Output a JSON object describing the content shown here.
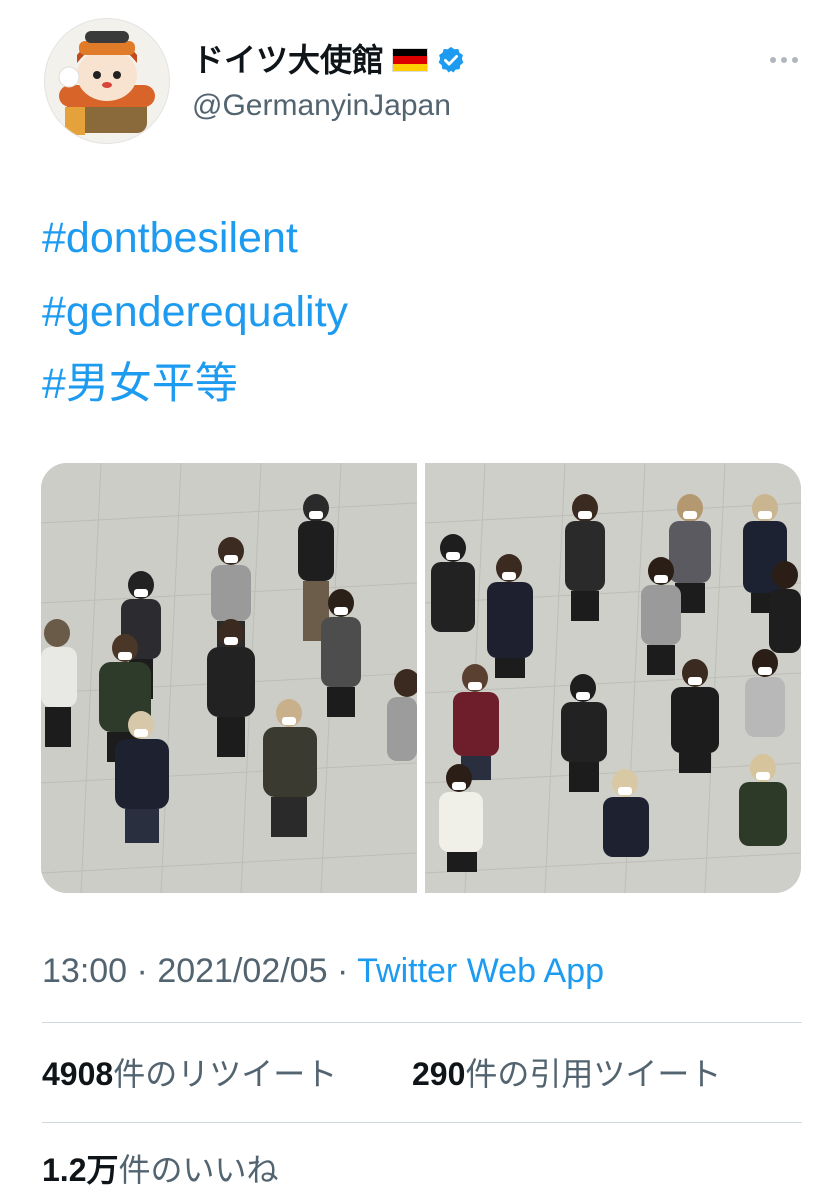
{
  "tweet": {
    "author": {
      "display_name": "ドイツ大使館",
      "handle": "@GermanyinJapan",
      "avatar_icon": "mascot-avatar-icon",
      "flag_icon": "germany-flag-icon",
      "verified_icon": "verified-badge-icon",
      "verified_color": "#1d9bf0"
    },
    "more_icon": "more-options-icon",
    "hashtags": [
      "#dontbesilent",
      "#genderequality",
      "#男女平等"
    ],
    "media": [
      {
        "type": "photo",
        "icon": "group-photo-left"
      },
      {
        "type": "photo",
        "icon": "group-photo-right"
      }
    ],
    "time": "13:00",
    "separator": "·",
    "date": "2021/02/05",
    "source": "Twitter Web App",
    "stats": {
      "retweets_count": "4908",
      "retweets_label": "件のリツイート",
      "quotes_count": "290",
      "quotes_label": "件の引用ツイート",
      "likes_count": "1.2万",
      "likes_label": "件のいいね"
    }
  },
  "colors": {
    "link": "#1d9bf0",
    "secondary_text": "#536471",
    "primary_text": "#0f1419",
    "divider": "#cfd9de"
  }
}
